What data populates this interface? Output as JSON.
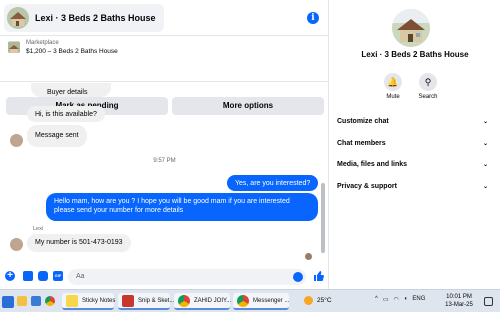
{
  "header": {
    "title": "Lexi · 3 Beds 2 Baths House"
  },
  "marketplace": {
    "label": "Marketplace",
    "item": "$1,200 – 3 Beds 2 Baths House",
    "mark_pending": "Mark as pending",
    "more_options": "More options"
  },
  "messages": {
    "buyer_details": "Buyer details",
    "available": "Hi, is this available?",
    "sent": "Message sent",
    "time": "9:57 PM",
    "yes": "Yes, are you interested?",
    "mam": "Hello mam, how are you ?  I hope you will be good mam if you are interested please send your number for more details",
    "sender": "Lexi",
    "number": "My number is 501-473-0193"
  },
  "composer": {
    "placeholder": "Aa",
    "gif": "GIF"
  },
  "details": {
    "name": "Lexi · 3 Beds 2 Baths House",
    "mute": "Mute",
    "search": "Search",
    "menu": [
      "Customize chat",
      "Chat members",
      "Media, files and links",
      "Privacy & support"
    ]
  },
  "taskbar": {
    "apps": [
      "Sticky Notes",
      "Snip & Sket...",
      "ZAHID JOIY...",
      "Messenger ..."
    ],
    "weather": "25°C",
    "lang": "ENG",
    "time": "10:01 PM",
    "date": "13-Mar-25"
  },
  "colors": {
    "accent": "#0866ff",
    "bubble_in": "#f0f0f0"
  }
}
